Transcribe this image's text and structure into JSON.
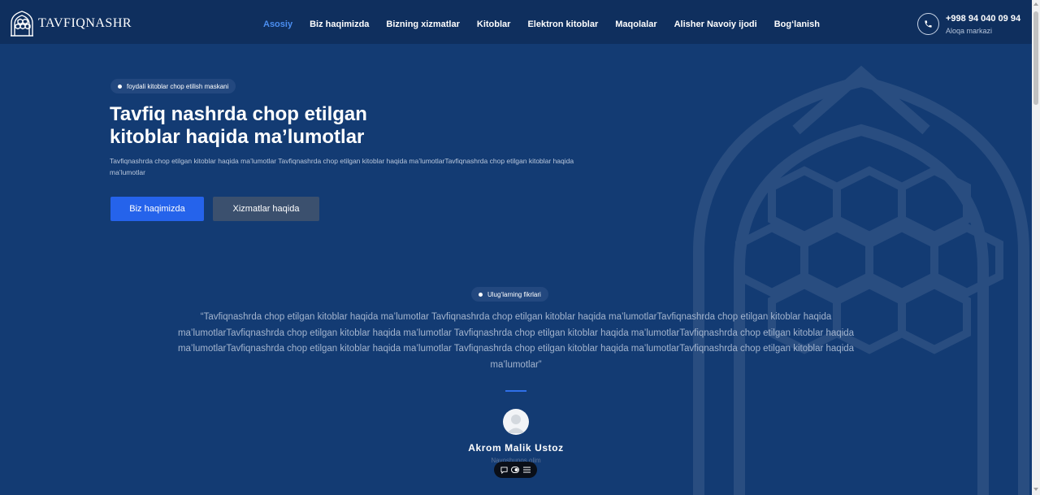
{
  "brand": {
    "name": "TAVFIQNASHR",
    "primary_color": "#2563eb",
    "background_color": "#133b73",
    "header_color": "#0f2f5e"
  },
  "nav": {
    "items": [
      {
        "label": "Asosiy",
        "active": true
      },
      {
        "label": "Biz haqimizda",
        "active": false
      },
      {
        "label": "Bizning xizmatlar",
        "active": false
      },
      {
        "label": "Kitoblar",
        "active": false
      },
      {
        "label": "Elektron kitoblar",
        "active": false
      },
      {
        "label": "Maqolalar",
        "active": false
      },
      {
        "label": "Alisher Navoiy ijodi",
        "active": false
      },
      {
        "label": "Bog‘lanish",
        "active": false
      }
    ]
  },
  "contact": {
    "icon": "phone-icon",
    "phone": "+998 94 040 09 94",
    "label": "Aloqa markazi"
  },
  "hero": {
    "badge": "foydali kitoblar chop etilish maskani",
    "title_line1": "Tavfiq nashrda chop etilgan",
    "title_line2": "kitoblar haqida ma’lumotlar",
    "description": "Tavfiqnashrda chop etilgan kitoblar haqida ma’lumotlar Tavfiqnashrda chop etilgan kitoblar haqida ma’lumotlarTavfiqnashrda chop etilgan kitoblar haqida ma’lumotlar",
    "primary_button": "Biz haqimizda",
    "secondary_button": "Xizmatlar haqida"
  },
  "testimonial": {
    "badge": "Ulug‘larning fikrlari",
    "quote": "“Tavfiqnashrda chop etilgan kitoblar haqida ma’lumotlar Tavfiqnashrda chop etilgan kitoblar haqida ma’lumotlarTavfiqnashrda chop etilgan kitoblar haqida ma’lumotlarTavfiqnashrda chop etilgan kitoblar haqida ma’lumotlar Tavfiqnashrda chop etilgan kitoblar haqida ma’lumotlarTavfiqnashrda chop etilgan kitoblar haqida ma’lumotlarTavfiqnashrda chop etilgan kitoblar haqida ma’lumotlar Tavfiqnashrda chop etilgan kitoblar haqida ma’lumotlarTavfiqnashrda chop etilgan kitoblar haqida ma’lumotlar”",
    "author_name": "Akrom Malik Ustoz",
    "author_role": "Navoshunos olim"
  },
  "toolbar": {
    "icons": [
      "comment-icon",
      "toggle-icon",
      "menu-icon"
    ]
  }
}
